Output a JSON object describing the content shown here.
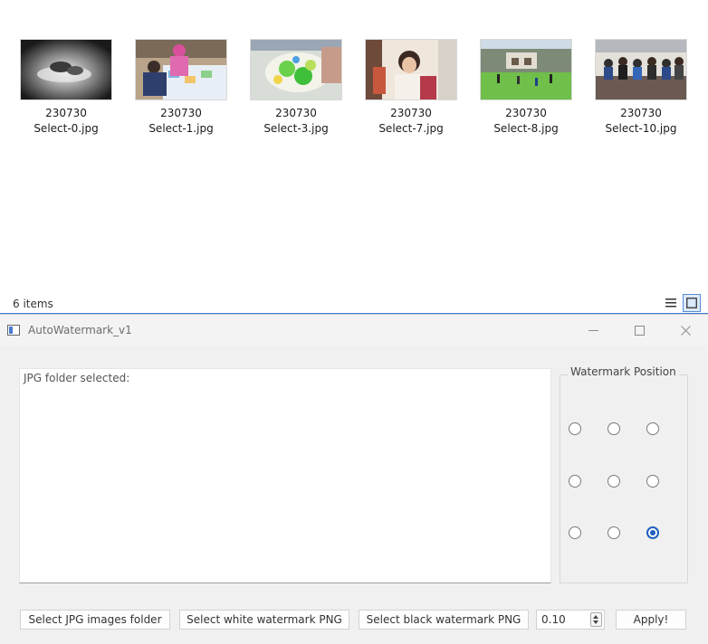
{
  "explorer": {
    "files": [
      {
        "line1": "230730",
        "line2": "Select-0.jpg"
      },
      {
        "line1": "230730",
        "line2": "Select-1.jpg"
      },
      {
        "line1": "230730",
        "line2": "Select-3.jpg"
      },
      {
        "line1": "230730",
        "line2": "Select-7.jpg"
      },
      {
        "line1": "230730",
        "line2": "Select-8.jpg"
      },
      {
        "line1": "230730",
        "line2": "Select-10.jpg"
      }
    ],
    "status": "6 items",
    "icons": {
      "details_view": "details-view-icon",
      "large_icons_view": "large-icons-view-icon"
    }
  },
  "window": {
    "title": "AutoWatermark_v1",
    "log_label": "JPG folder selected:",
    "position_group_title": "Watermark Position",
    "selected_position": "bottom-right",
    "buttons": {
      "select_jpg": "Select JPG images folder",
      "select_white": "Select white watermark PNG",
      "select_black": "Select black watermark PNG",
      "apply": "Apply!"
    },
    "opacity_value": "0.10",
    "accent_color": "#1f5fbf"
  }
}
